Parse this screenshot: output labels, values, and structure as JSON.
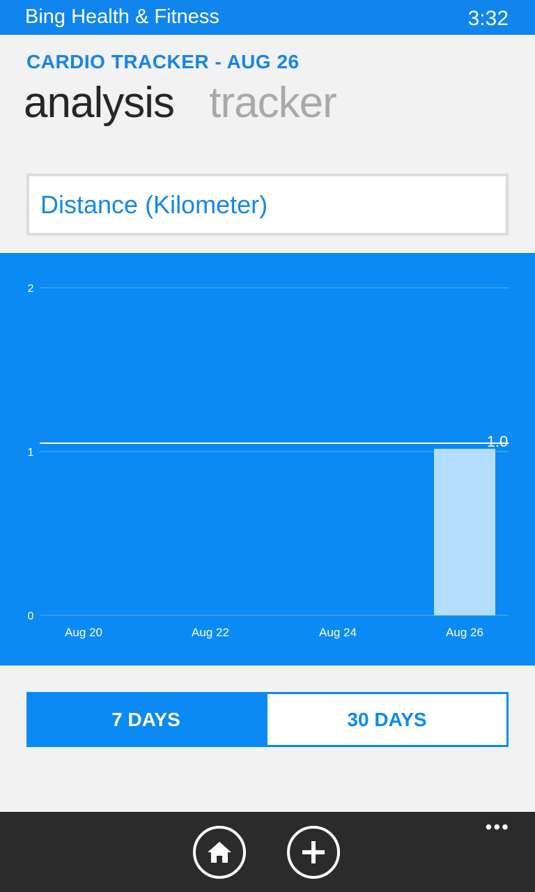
{
  "status_bar": {
    "app_title": "Bing Health & Fitness",
    "time": "3:32"
  },
  "header": {
    "title": "CARDIO TRACKER - AUG 26",
    "pivots": [
      {
        "label": "analysis",
        "active": true
      },
      {
        "label": "tracker",
        "active": false
      }
    ]
  },
  "metric_selector": {
    "value": "Distance (Kilometer)"
  },
  "chart_data": {
    "type": "bar",
    "categories": [
      "Aug 20",
      "Aug 22",
      "Aug 24",
      "Aug 26"
    ],
    "series": [
      {
        "x": "Aug 26",
        "value": 1.0
      }
    ],
    "value_label": "1.0",
    "y_ticks": [
      "0",
      "1",
      "2"
    ],
    "ylim": [
      0,
      2
    ],
    "reference_value": 1.0,
    "grid": true,
    "background_color": "#0a8af2",
    "bar_color": "#b3dcfd"
  },
  "range_toggle": {
    "options": [
      {
        "label": "7 DAYS",
        "selected": true
      },
      {
        "label": "30 DAYS",
        "selected": false
      }
    ]
  },
  "app_bar": {
    "buttons": [
      {
        "icon": "home-icon"
      },
      {
        "icon": "add-icon"
      }
    ],
    "more": "•••"
  },
  "colors": {
    "accent": "#1085ee",
    "app_bar": "#2b2b2b"
  }
}
